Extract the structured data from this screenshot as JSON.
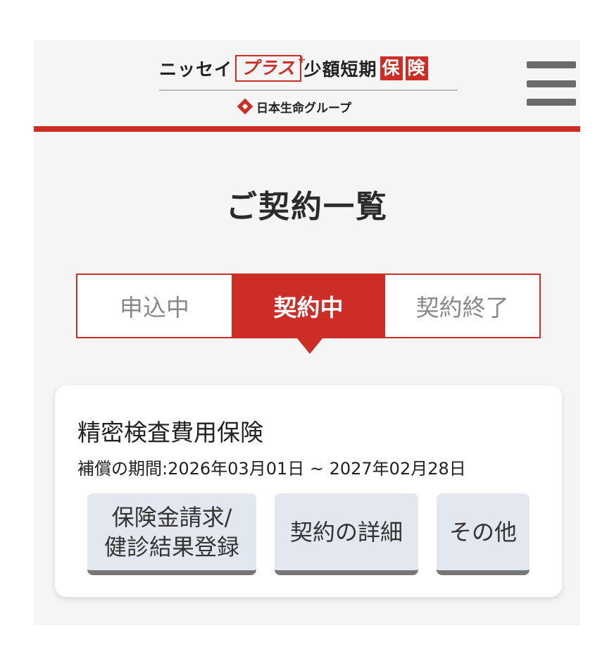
{
  "header": {
    "logo_part1": "ニッセイ",
    "logo_plus": "プラス",
    "logo_plus_star": "+",
    "logo_part2": "少額短期",
    "logo_box1": "保",
    "logo_box2": "険",
    "group_name": "日本生命グループ",
    "brand_color": "#cc2e27"
  },
  "page": {
    "title": "ご契約一覧"
  },
  "tabs": [
    {
      "label": "申込中",
      "active": false
    },
    {
      "label": "契約中",
      "active": true
    },
    {
      "label": "契約終了",
      "active": false
    }
  ],
  "contract": {
    "name": "精密検査費用保険",
    "period": "補償の期間:2026年03月01日 ~ 2027年02月28日",
    "actions": {
      "claim_line1": "保険金請求/",
      "claim_line2": "健診結果登録",
      "details": "契約の詳細",
      "other": "その他"
    }
  }
}
